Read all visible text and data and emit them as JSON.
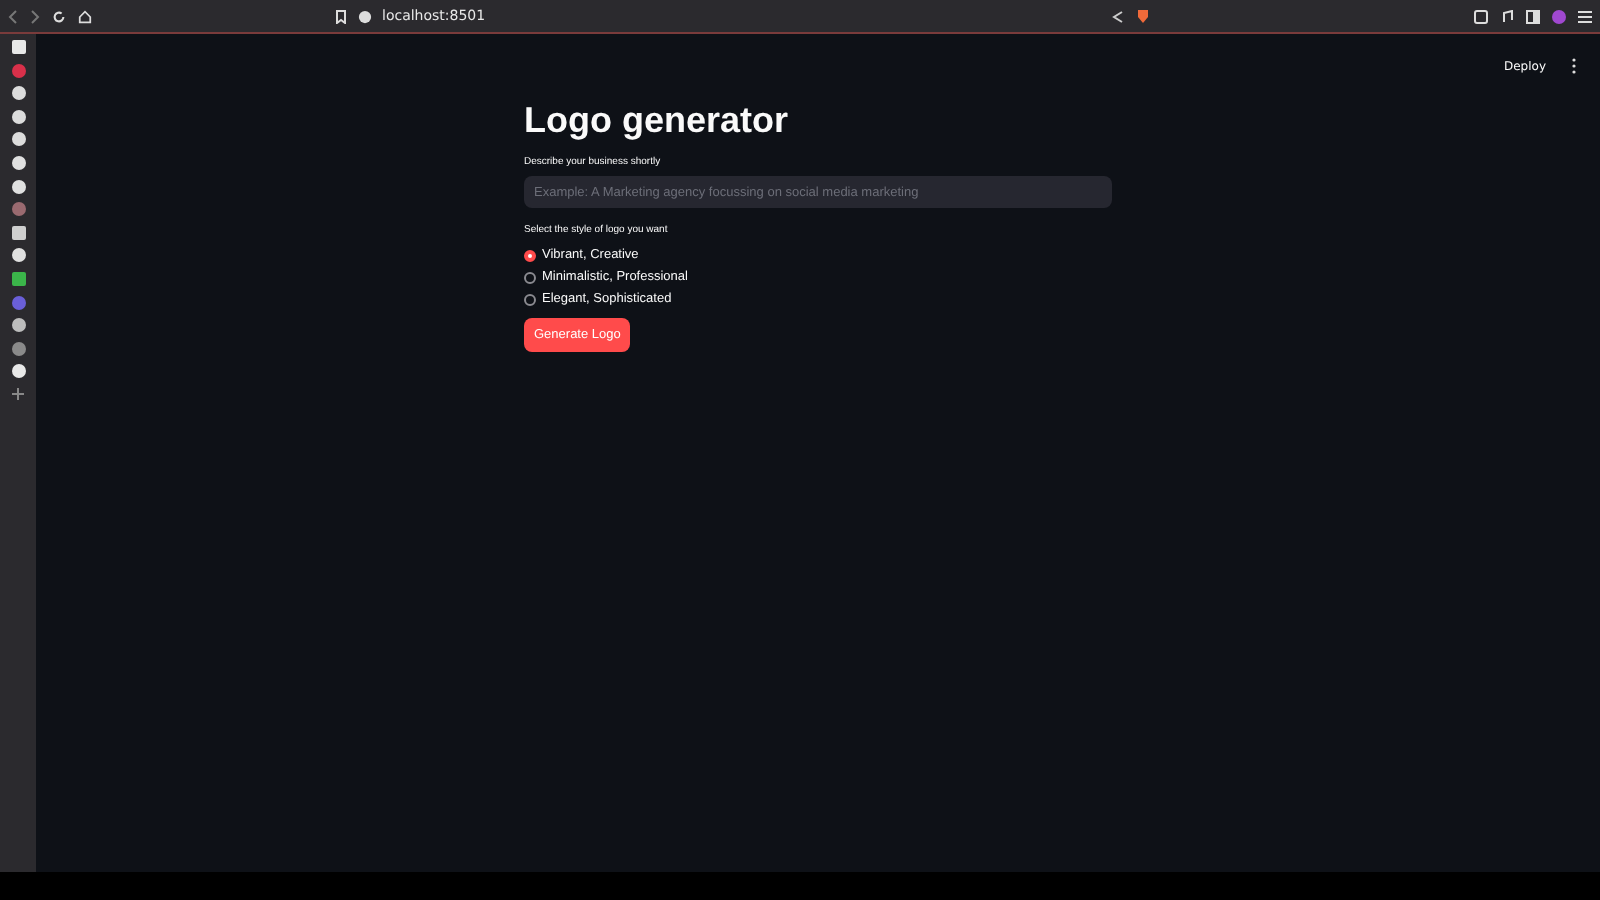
{
  "browser": {
    "url": "localhost:8501"
  },
  "header": {
    "deploy": "Deploy"
  },
  "title": "Logo generator",
  "business": {
    "label": "Describe your business shortly",
    "placeholder": "Example: A Marketing agency focussing on social media marketing"
  },
  "style": {
    "label": "Select the style of logo you want",
    "options": [
      {
        "label": "Vibrant, Creative",
        "selected": true
      },
      {
        "label": "Minimalistic, Professional",
        "selected": false
      },
      {
        "label": "Elegant, Sophisticated",
        "selected": false
      }
    ]
  },
  "button": "Generate Logo"
}
